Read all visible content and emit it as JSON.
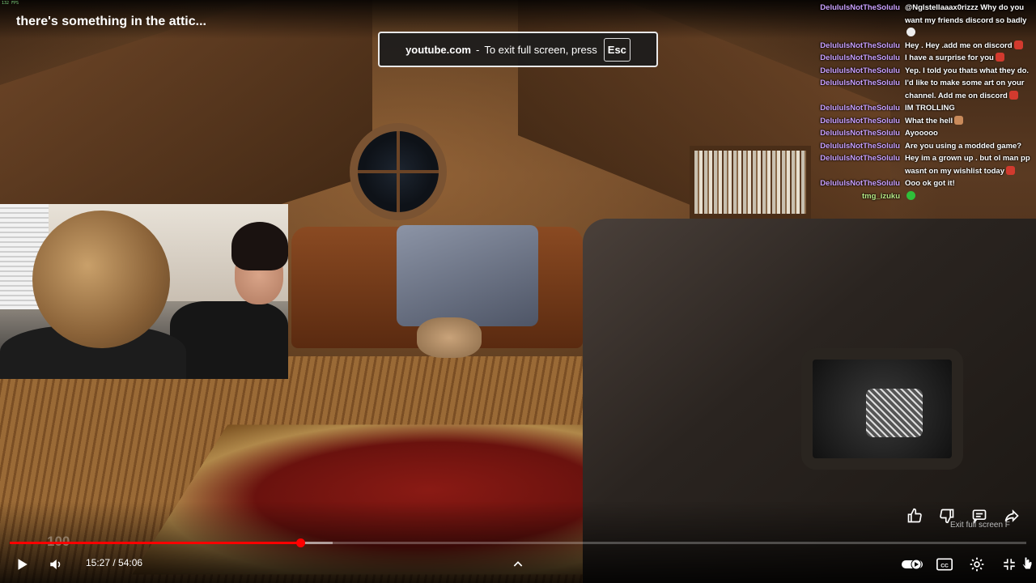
{
  "fps_label": "132 FPS",
  "video_title": "there's something in the attic...",
  "fullscreen_notice": {
    "domain": "youtube.com",
    "message": "To exit full screen, press",
    "key": "Esc"
  },
  "chat": [
    {
      "user": "DelululsNotTheSolulu",
      "text": "@Nglstellaaax0rizzz Why do you want my friends discord so badly"
    },
    {
      "user": "DelululsNotTheSolulu",
      "text": "Hey . Hey .add me on discord"
    },
    {
      "user": "DelululsNotTheSolulu",
      "text": "I have a surprise for you"
    },
    {
      "user": "DelululsNotTheSolulu",
      "text": "Yep. I told you thats what they do."
    },
    {
      "user": "DelululsNotTheSolulu",
      "text": "I'd like to make some art on your channel. Add me on discord"
    },
    {
      "user": "DelululsNotTheSolulu",
      "text": "IM TROLLING"
    },
    {
      "user": "DelululsNotTheSolulu",
      "text": "What the hell"
    },
    {
      "user": "DelululsNotTheSolulu",
      "text": "Ayooooo"
    },
    {
      "user": "DelululsNotTheSolulu",
      "text": "Are you using a modded game?"
    },
    {
      "user": "DelululsNotTheSolulu",
      "text": "Hey im a grown up . but ol man pp wasnt on my wishlist today"
    },
    {
      "user": "DelululsNotTheSolulu",
      "text": "Ooo ok got it!"
    },
    {
      "user": "tmg_izuku",
      "text": ""
    }
  ],
  "overlay_count": "100",
  "exit_fullscreen_tooltip": "Exit full screen  F",
  "player": {
    "current_time": "15:27",
    "separator": " / ",
    "duration": "54:06",
    "progress_fraction": 0.2856,
    "buffer_fraction": 0.318,
    "accent_color": "#ff0000"
  },
  "icons": [
    "like-icon",
    "dislike-icon",
    "comment-icon",
    "share-icon",
    "play-icon",
    "volume-icon",
    "chevron-up-icon",
    "autoplay-toggle-icon",
    "captions-icon",
    "settings-icon",
    "exit-fullscreen-icon"
  ]
}
